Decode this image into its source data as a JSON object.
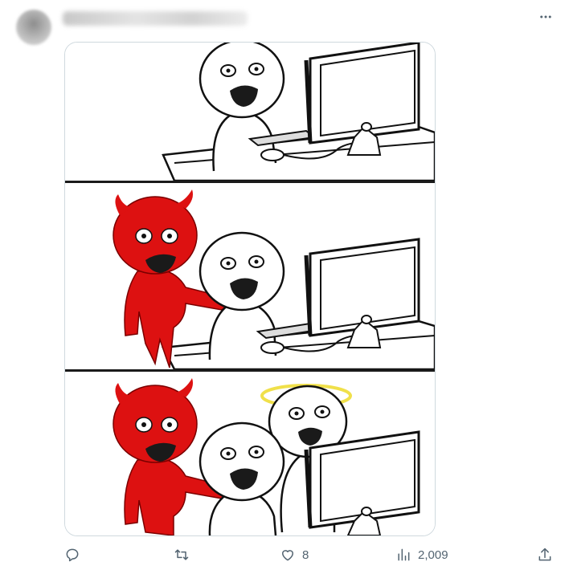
{
  "post": {
    "more_icon": "more-horizontal-icon",
    "author_avatar": "blurred-avatar",
    "author_name_blurred": true
  },
  "media": {
    "alt": "three-panel-comic",
    "panels": [
      {
        "characters": [
          "person-at-computer"
        ]
      },
      {
        "characters": [
          "devil",
          "person-at-computer"
        ]
      },
      {
        "characters": [
          "devil",
          "person-at-computer",
          "angel"
        ]
      }
    ],
    "colors": {
      "devil": "#dd1111",
      "halo": "#f0e04a",
      "outline": "#111111"
    }
  },
  "actions": {
    "reply": {
      "icon": "reply-icon",
      "count": ""
    },
    "retweet": {
      "icon": "retweet-icon",
      "count": ""
    },
    "like": {
      "icon": "heart-icon",
      "count": "8"
    },
    "views": {
      "icon": "views-icon",
      "count": "2,009"
    },
    "share": {
      "icon": "share-icon"
    }
  }
}
